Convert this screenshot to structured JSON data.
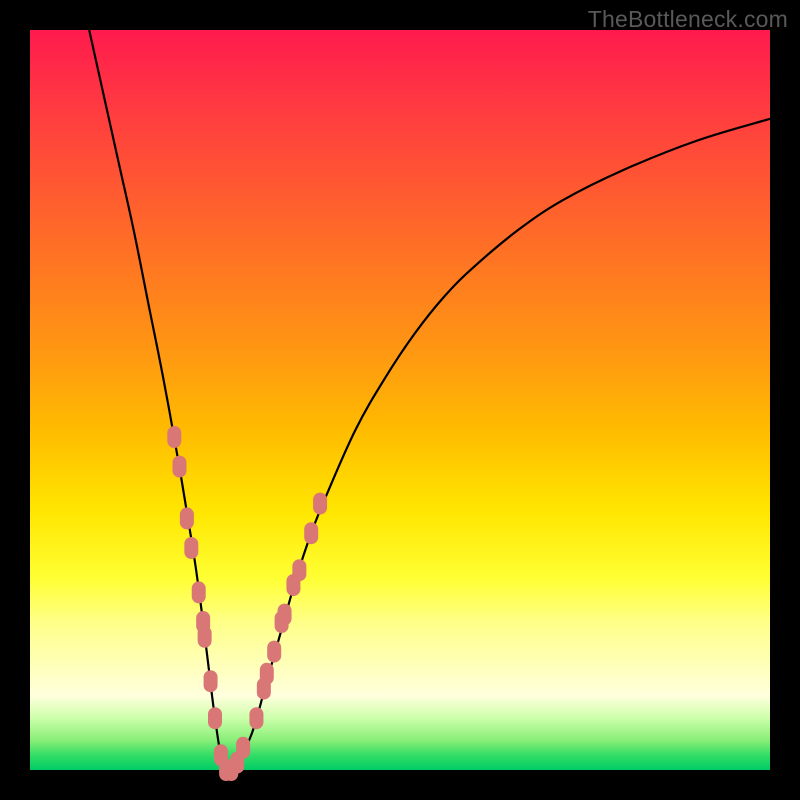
{
  "watermark": "TheBottleneck.com",
  "colors": {
    "background_frame": "#000000",
    "gradient_top": "#ff1a4d",
    "gradient_mid": "#ffe600",
    "gradient_bottom": "#00cc66",
    "curve": "#000000",
    "markers": "#d97777"
  },
  "chart_data": {
    "type": "line",
    "title": "",
    "xlabel": "",
    "ylabel": "",
    "xlim": [
      0,
      100
    ],
    "ylim": [
      0,
      100
    ],
    "grid": false,
    "legend": false,
    "series": [
      {
        "name": "bottleneck-curve",
        "x": [
          8,
          10,
          12,
          14,
          16,
          18,
          20,
          22,
          23,
          24,
          25,
          26,
          27,
          28,
          30,
          32,
          34,
          36,
          38,
          40,
          44,
          48,
          52,
          56,
          60,
          66,
          72,
          80,
          90,
          100
        ],
        "values": [
          100,
          91,
          82,
          73,
          63,
          53,
          42,
          30,
          23,
          15,
          7,
          1,
          0,
          1,
          5,
          12,
          19,
          26,
          32,
          37,
          46,
          53,
          59,
          64,
          68,
          73,
          77,
          81,
          85,
          88
        ]
      }
    ],
    "markers": {
      "name": "highlight-dots",
      "points": [
        {
          "x": 19.5,
          "value": 45
        },
        {
          "x": 20.2,
          "value": 41
        },
        {
          "x": 21.2,
          "value": 34
        },
        {
          "x": 21.8,
          "value": 30
        },
        {
          "x": 22.8,
          "value": 24
        },
        {
          "x": 23.4,
          "value": 20
        },
        {
          "x": 23.6,
          "value": 18
        },
        {
          "x": 24.4,
          "value": 12
        },
        {
          "x": 25.0,
          "value": 7
        },
        {
          "x": 25.8,
          "value": 2
        },
        {
          "x": 26.5,
          "value": 0
        },
        {
          "x": 27.2,
          "value": 0
        },
        {
          "x": 28.0,
          "value": 1
        },
        {
          "x": 28.8,
          "value": 3
        },
        {
          "x": 30.6,
          "value": 7
        },
        {
          "x": 31.6,
          "value": 11
        },
        {
          "x": 32.0,
          "value": 13
        },
        {
          "x": 33.0,
          "value": 16
        },
        {
          "x": 34.0,
          "value": 20
        },
        {
          "x": 34.4,
          "value": 21
        },
        {
          "x": 35.6,
          "value": 25
        },
        {
          "x": 36.4,
          "value": 27
        },
        {
          "x": 38.0,
          "value": 32
        },
        {
          "x": 39.2,
          "value": 36
        }
      ]
    }
  }
}
